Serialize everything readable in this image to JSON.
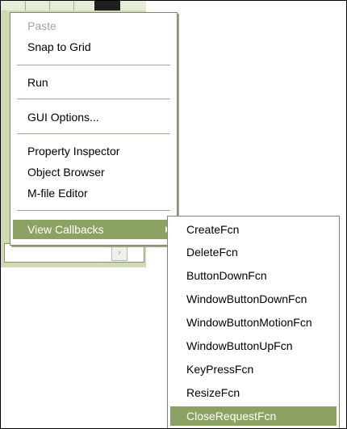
{
  "context_menu": {
    "items": [
      {
        "label": "Paste",
        "enabled": false
      },
      {
        "label": "Snap to Grid",
        "enabled": true
      },
      {
        "label": "Run",
        "enabled": true
      },
      {
        "label": "GUI Options...",
        "enabled": true
      },
      {
        "label": "Property Inspector",
        "enabled": true
      },
      {
        "label": "Object Browser",
        "enabled": true
      },
      {
        "label": "M-file Editor",
        "enabled": true
      },
      {
        "label": "View Callbacks",
        "enabled": true,
        "has_submenu": true,
        "highlighted": true
      }
    ]
  },
  "callbacks_submenu": {
    "items": [
      {
        "label": "CreateFcn"
      },
      {
        "label": "DeleteFcn"
      },
      {
        "label": "ButtonDownFcn"
      },
      {
        "label": "WindowButtonDownFcn"
      },
      {
        "label": "WindowButtonMotionFcn"
      },
      {
        "label": "WindowButtonUpFcn"
      },
      {
        "label": "KeyPressFcn"
      },
      {
        "label": "ResizeFcn"
      },
      {
        "label": "CloseRequestFcn",
        "highlighted": true
      }
    ]
  },
  "icons": {
    "submenu_arrow": "chevron-right-icon",
    "scroll_arrow": "scroll-right-arrow-icon"
  },
  "colors": {
    "highlight": "#8ba262",
    "menu_border": "#7d8a63",
    "disabled_text": "#a3a3a3",
    "window_bg": "#cfd9b3"
  }
}
